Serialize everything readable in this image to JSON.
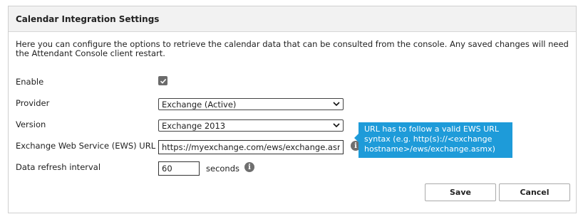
{
  "panel": {
    "title": "Calendar Integration Settings",
    "description": "Here you can configure the options to retrieve the calendar data that can be consulted from the console. Any saved changes will need the Attendant Console client restart."
  },
  "form": {
    "enable": {
      "label": "Enable",
      "checked": true
    },
    "provider": {
      "label": "Provider",
      "value": "Exchange (Active)"
    },
    "version": {
      "label": "Version",
      "value": "Exchange 2013"
    },
    "ews_url": {
      "label": "Exchange Web Service (EWS) URL",
      "value": "https://myexchange.com/ews/exchange.asmx"
    },
    "refresh": {
      "label": "Data refresh interval",
      "value": "60",
      "unit": "seconds"
    }
  },
  "tooltip": {
    "text": "URL has to follow a valid EWS URL syntax (e.g. http(s)://<exchange hostname>/ews/exchange.asmx)",
    "color": "#1e9bd9"
  },
  "icons": {
    "info": "info-icon",
    "check": "check-icon",
    "chevron": "chevron-down-icon"
  },
  "buttons": {
    "save": "Save",
    "cancel": "Cancel"
  }
}
